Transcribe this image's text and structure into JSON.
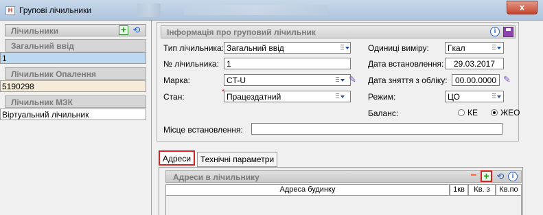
{
  "window": {
    "title": "Групові лічильники",
    "app_icon_letter": "Н",
    "close_glyph": "x"
  },
  "left_panel": {
    "header": "Лічильники",
    "sections": [
      {
        "label": "Загальний ввід",
        "value": "1",
        "row_color": "#b9d8f2"
      },
      {
        "label": "Лічильник Опалення",
        "value": "5190298",
        "row_color": "#f4ecd9"
      },
      {
        "label": "Лічильник МЗК",
        "value": "Віртуальний лічильник",
        "row_color": "#ffffff"
      }
    ]
  },
  "info": {
    "header": "Інформація про груповий лічильник",
    "fields": {
      "type_label": "Тип лічильника:",
      "type_value": "Загальний ввід",
      "number_label": "№ лічильника:",
      "number_value": "1",
      "brand_label": "Марка:",
      "brand_value": "CT-U",
      "state_label": "Стан:",
      "state_value": "Працездатний",
      "units_label": "Одиниці виміру:",
      "units_value": "Гкал",
      "install_date_label": "Дата встановлення:",
      "install_date_value": "29.03.2017",
      "removal_date_label": "Дата зняття з обліку:",
      "removal_date_value": "00.00.0000",
      "mode_label": "Режим:",
      "mode_value": "ЦО",
      "balance_label": "Баланс:",
      "balance_options": [
        "КЕ",
        "ЖЕО"
      ],
      "balance_selected": "ЖЕО",
      "location_label": "Місце встановлення:",
      "location_value": ""
    },
    "required_mark": "*"
  },
  "tabs": [
    "Адреси",
    "Технічні параметри"
  ],
  "active_tab": "Адреси",
  "addresses": {
    "header": "Адреси в лічильнику",
    "columns": [
      "Адреса будинку",
      "1кв",
      "Кв. з",
      "Кв.по"
    ],
    "rows": []
  },
  "colors": {
    "highlight_border": "#d32323",
    "add_green": "#1b9b1b",
    "refresh_blue": "#1e63c7",
    "close_red": "#c7452e"
  },
  "icons": {
    "add": "plus-icon",
    "refresh": "refresh-icon",
    "info": "info-icon",
    "save": "save-icon",
    "edit": "pencil-icon",
    "remove": "minus-icon",
    "dropdown": "dropdown-icon"
  }
}
